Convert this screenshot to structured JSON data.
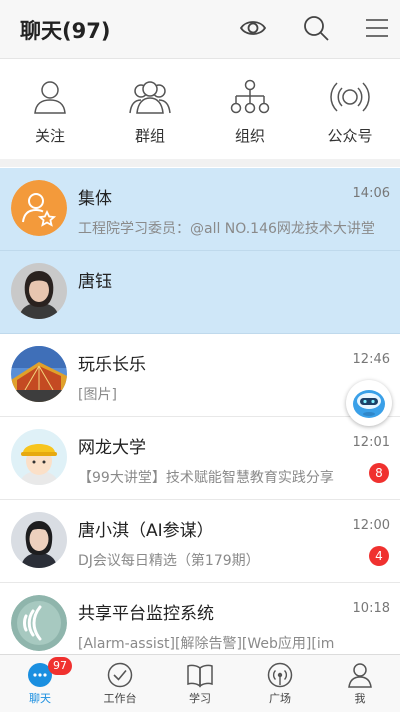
{
  "header": {
    "title": "聊天(97)"
  },
  "quick_actions": [
    {
      "label": "关注",
      "icon": "person-icon"
    },
    {
      "label": "群组",
      "icon": "group-icon"
    },
    {
      "label": "组织",
      "icon": "org-chart-icon"
    },
    {
      "label": "公众号",
      "icon": "broadcast-icon"
    }
  ],
  "chats": [
    {
      "name": "集体",
      "time": "14:06",
      "preview": "工程院学习委员：@all NO.146网龙技术大讲堂",
      "badge": "",
      "pinned": true
    },
    {
      "name": "唐钰",
      "time": "",
      "preview": "",
      "badge": "",
      "pinned": true
    },
    {
      "name": "玩乐长乐",
      "time": "12:46",
      "preview": "[图片]",
      "badge": "",
      "pinned": false
    },
    {
      "name": "网龙大学",
      "time": "12:01",
      "preview": "【99大讲堂】技术赋能智慧教育实践分享",
      "badge": "8",
      "pinned": false
    },
    {
      "name": "唐小淇（AI参谋）",
      "time": "12:00",
      "preview": "DJ会议每日精选（第179期）",
      "badge": "4",
      "pinned": false
    },
    {
      "name": "共享平台监控系统",
      "time": "10:18",
      "preview": "[Alarm-assist][解除告警][Web应用][im",
      "badge": "",
      "pinned": false
    }
  ],
  "tabs": [
    {
      "label": "聊天",
      "badge": "97",
      "active": true
    },
    {
      "label": "工作台"
    },
    {
      "label": "学习"
    },
    {
      "label": "广场"
    },
    {
      "label": "我"
    }
  ],
  "colors": {
    "accent": "#1a8fe0",
    "badge": "#f0312f",
    "pinned_bg": "#cfe7f8"
  }
}
